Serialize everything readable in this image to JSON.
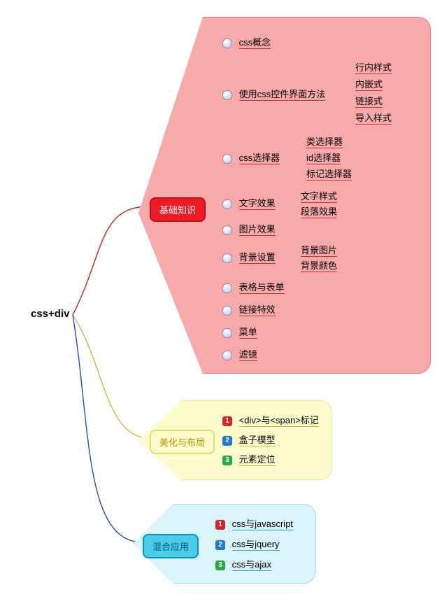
{
  "root": {
    "label": "css+div"
  },
  "branches": {
    "basic": {
      "label": "基础知识"
    },
    "layout": {
      "label": "美化与布局"
    },
    "mix": {
      "label": "混合应用"
    }
  },
  "basic_children": [
    {
      "label": "css概念"
    },
    {
      "label": "使用css控件界面方法",
      "children": [
        {
          "label": "行内样式"
        },
        {
          "label": "内嵌式"
        },
        {
          "label": "链接式"
        },
        {
          "label": "导入样式"
        }
      ]
    },
    {
      "label": "css选择器",
      "children": [
        {
          "label": "类选择器"
        },
        {
          "label": "id选择器"
        },
        {
          "label": "标记选择器"
        }
      ]
    },
    {
      "label": "文字效果",
      "children": [
        {
          "label": "文字样式"
        },
        {
          "label": "段落效果"
        }
      ]
    },
    {
      "label": "图片效果"
    },
    {
      "label": "背景设置",
      "children": [
        {
          "label": "背景图片"
        },
        {
          "label": "背景颜色"
        }
      ]
    },
    {
      "label": "表格与表单"
    },
    {
      "label": "链接特效"
    },
    {
      "label": "菜单"
    },
    {
      "label": "滤镜"
    }
  ],
  "layout_children": [
    {
      "num": 1,
      "label": "<div>与<span>标记"
    },
    {
      "num": 2,
      "label": "盒子模型"
    },
    {
      "num": 3,
      "label": "元素定位"
    }
  ],
  "mix_children": [
    {
      "num": 1,
      "label": "css与javascript"
    },
    {
      "num": 2,
      "label": "css与jquery"
    },
    {
      "num": 3,
      "label": "css与ajax"
    }
  ],
  "chart_data": {
    "type": "mindmap",
    "root": "css+div",
    "branches": [
      {
        "label": "基础知识",
        "color": "#ed1c24",
        "children": [
          "css概念",
          {
            "label": "使用css控件界面方法",
            "children": [
              "行内样式",
              "内嵌式",
              "链接式",
              "导入样式"
            ]
          },
          {
            "label": "css选择器",
            "children": [
              "类选择器",
              "id选择器",
              "标记选择器"
            ]
          },
          {
            "label": "文字效果",
            "children": [
              "文字样式",
              "段落效果"
            ]
          },
          "图片效果",
          {
            "label": "背景设置",
            "children": [
              "背景图片",
              "背景颜色"
            ]
          },
          "表格与表单",
          "链接特效",
          "菜单",
          "滤镜"
        ]
      },
      {
        "label": "美化与布局",
        "color": "#ece98a",
        "children": [
          "<div>与<span>标记",
          "盒子模型",
          "元素定位"
        ]
      },
      {
        "label": "混合应用",
        "color": "#4ecbe9",
        "children": [
          "css与javascript",
          "css与jquery",
          "css与ajax"
        ]
      }
    ]
  }
}
